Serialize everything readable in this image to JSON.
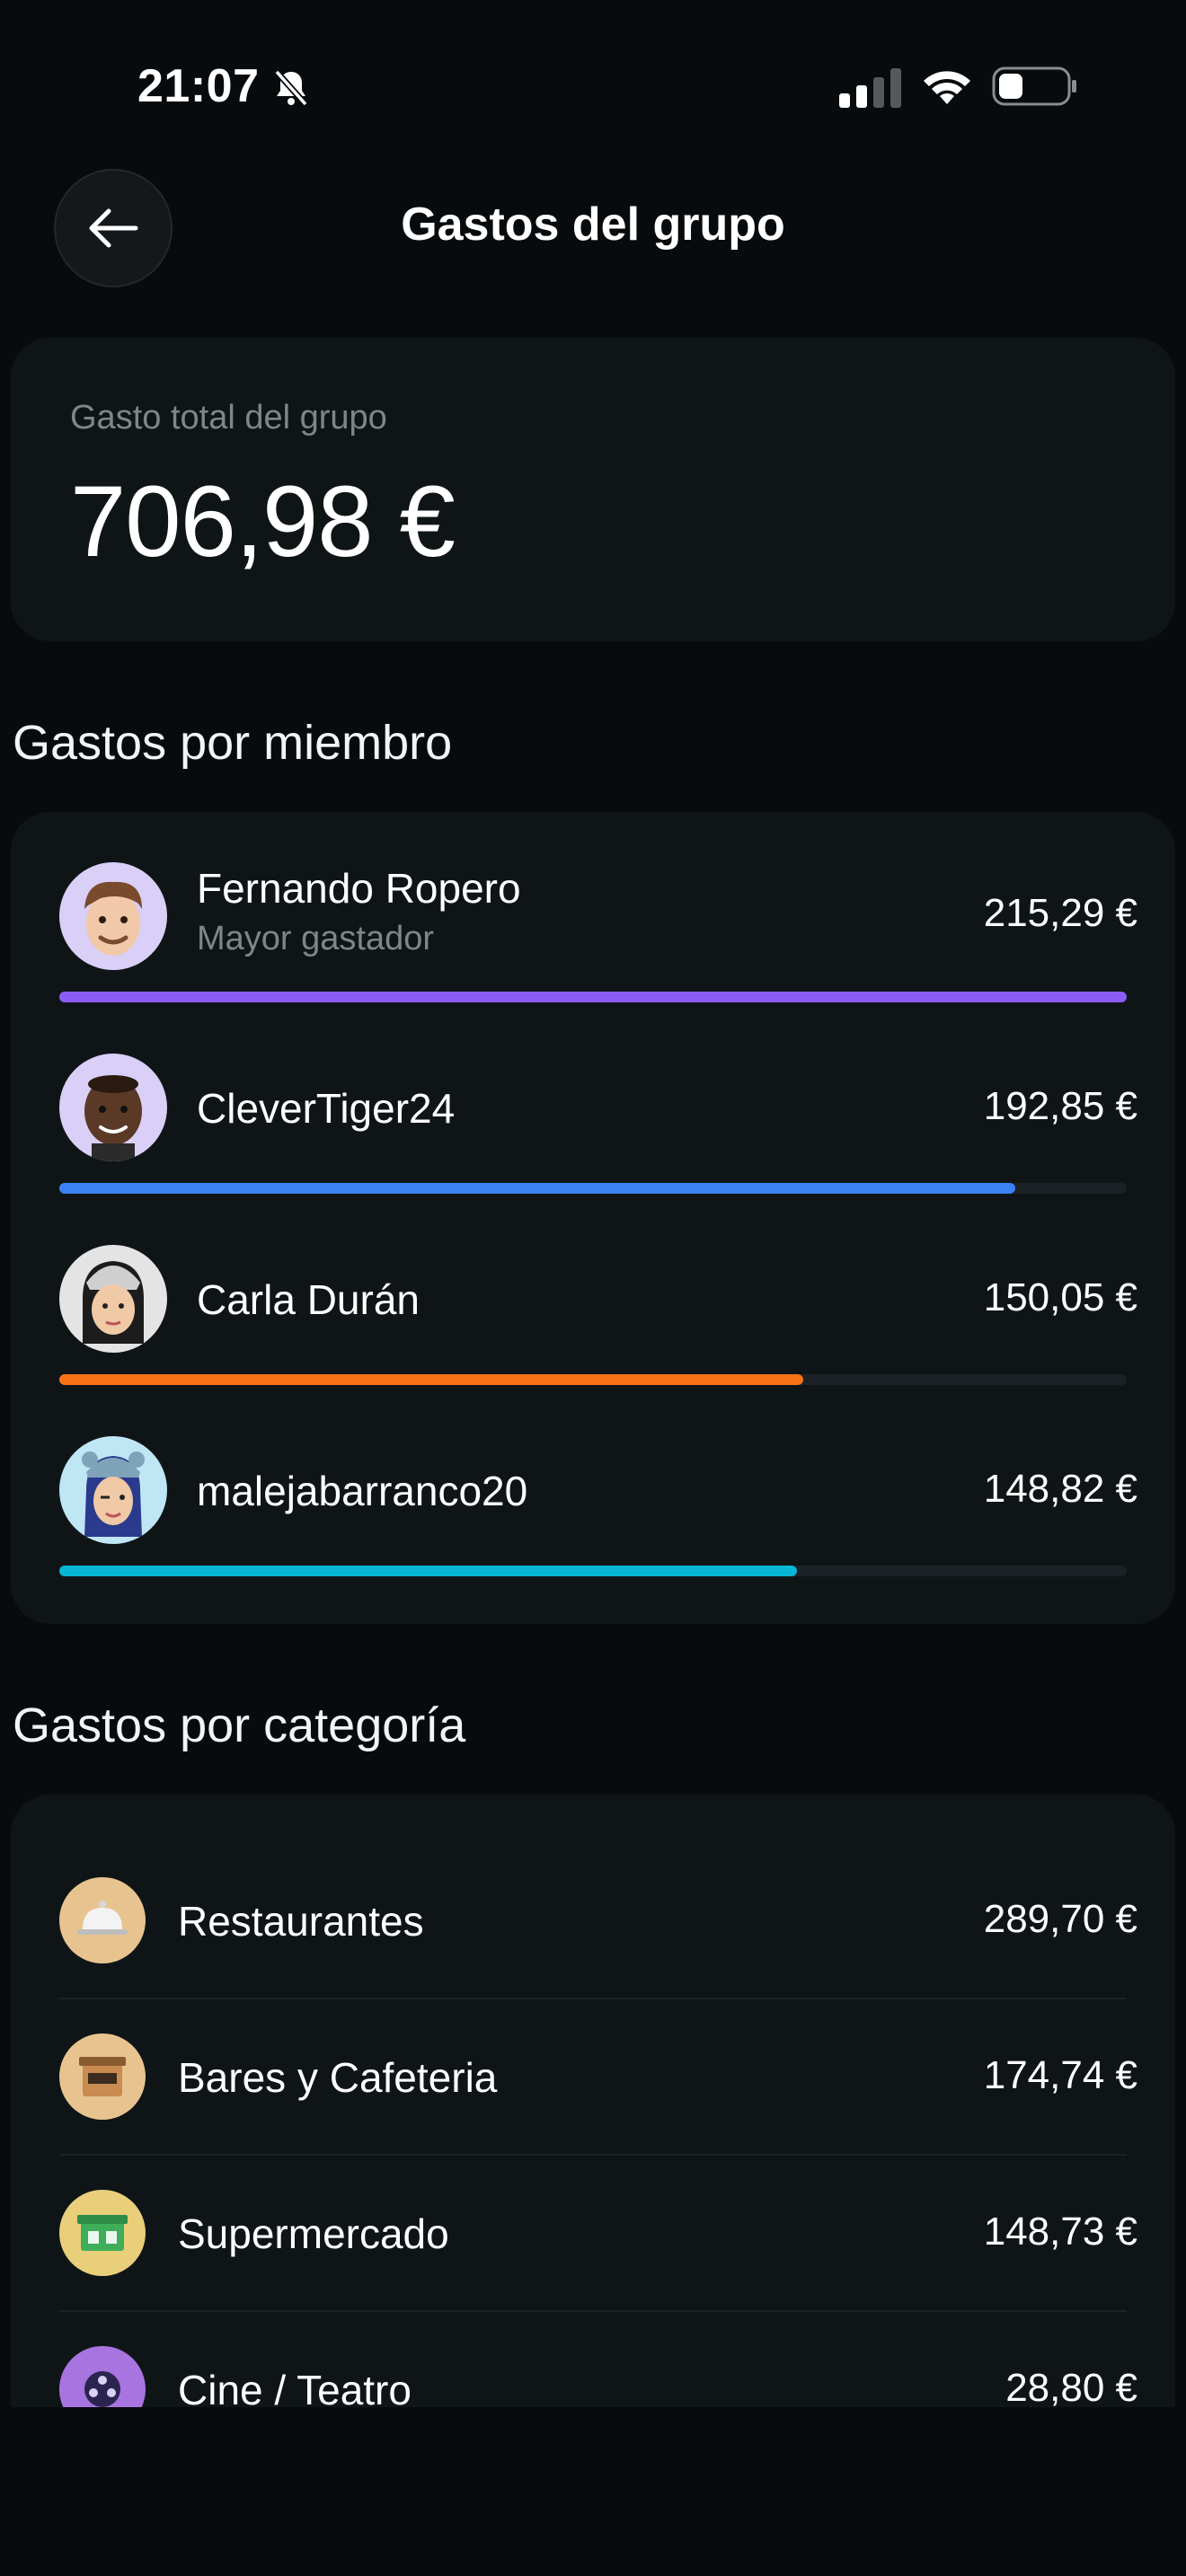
{
  "status_bar": {
    "time": "21:07",
    "icons": [
      "bell-slash-icon",
      "cellular-signal-icon",
      "wifi-icon",
      "battery-icon"
    ]
  },
  "header": {
    "title": "Gastos del grupo",
    "back_icon": "arrow-left-icon"
  },
  "total": {
    "label": "Gasto total del grupo",
    "value": "706,98 €"
  },
  "members_section": {
    "title": "Gastos por miembro",
    "members": [
      {
        "name": "Fernando Ropero",
        "subtitle": "Mayor gastador",
        "amount": "215,29 €",
        "share": 1.0,
        "color": "#8b5cf6",
        "avatar_bg": "#d9cff7"
      },
      {
        "name": "CleverTiger24",
        "subtitle": "",
        "amount": "192,85 €",
        "share": 0.896,
        "color": "#3b82f6",
        "avatar_bg": "#d9cff7"
      },
      {
        "name": "Carla Durán",
        "subtitle": "",
        "amount": "150,05 €",
        "share": 0.697,
        "color": "#f97316",
        "avatar_bg": "#e4e4e4"
      },
      {
        "name": "malejabarranco20",
        "subtitle": "",
        "amount": "148,82 €",
        "share": 0.691,
        "color": "#06b6d4",
        "avatar_bg": "#bfe6f5"
      }
    ]
  },
  "categories_section": {
    "title": "Gastos por categoría",
    "categories": [
      {
        "label": "Restaurantes",
        "amount": "289,70 €",
        "icon": "food-cloche-icon",
        "icon_bg": "#e7c48f"
      },
      {
        "label": "Bares y Cafeteria",
        "amount": "174,74 €",
        "icon": "coffee-shop-icon",
        "icon_bg": "#e7c48f"
      },
      {
        "label": "Supermercado",
        "amount": "148,73 €",
        "icon": "grocery-store-icon",
        "icon_bg": "#e9cf7a"
      },
      {
        "label": "Cine / Teatro",
        "amount": "28,80 €",
        "icon": "film-reel-icon",
        "icon_bg": "#a874e0"
      }
    ]
  },
  "colors": {
    "background": "#080b0d",
    "card": "#0f1517",
    "muted_text": "#7f8689"
  }
}
